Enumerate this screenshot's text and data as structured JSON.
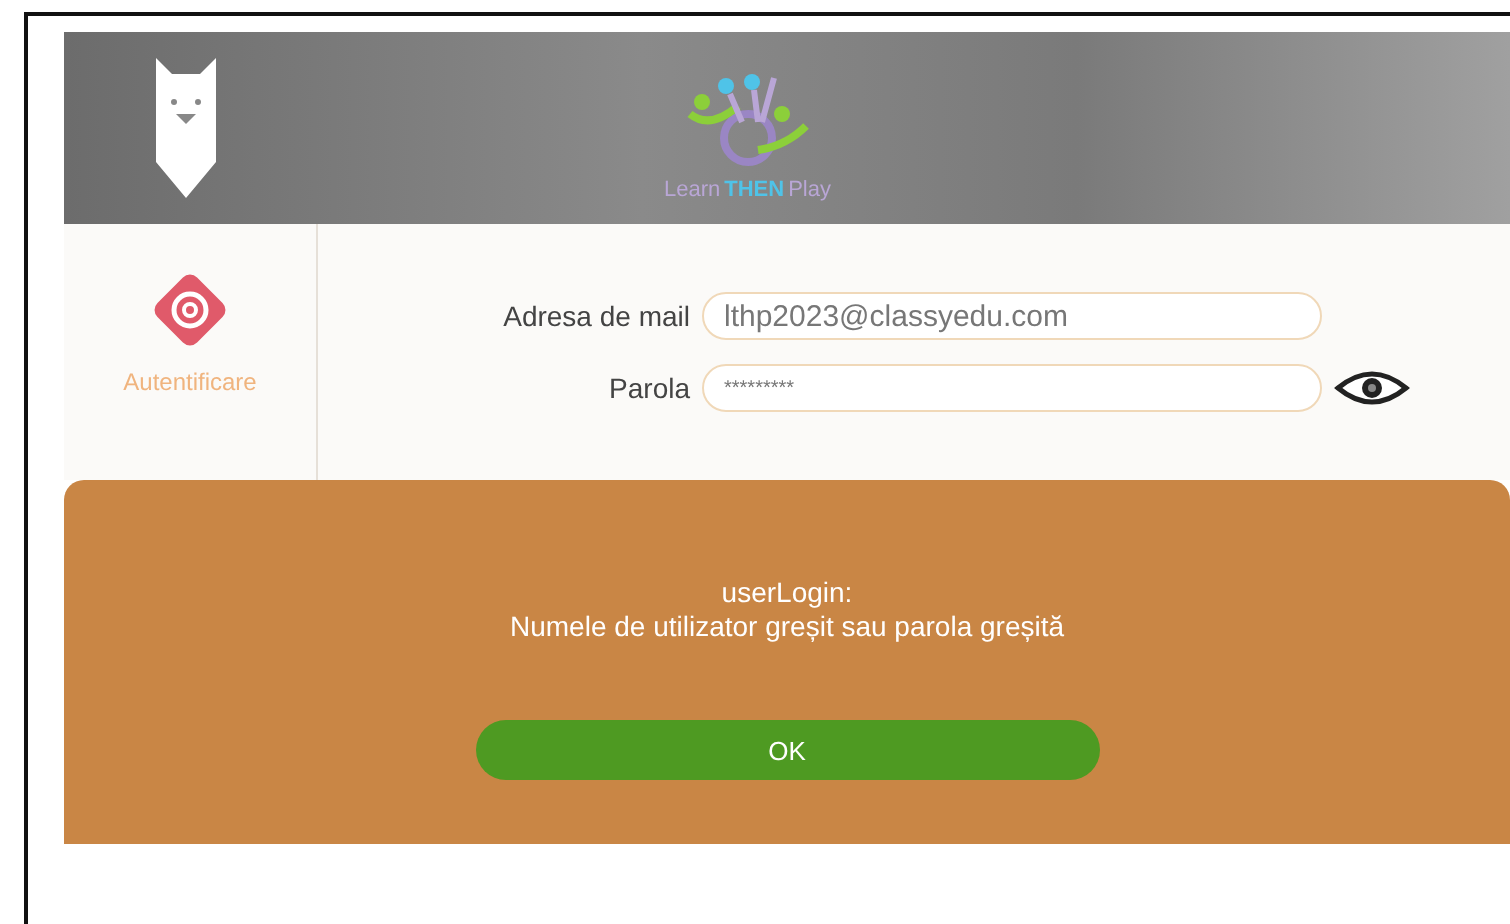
{
  "header": {
    "logo_words": [
      {
        "text": "Learn",
        "color": "#b9a6d6"
      },
      {
        "text": "THEN",
        "color": "#4fc3e8"
      },
      {
        "text": "Play",
        "color": "#b9a6d6"
      }
    ]
  },
  "sidebar": {
    "label": "Autentificare",
    "selected": true
  },
  "form": {
    "fields": [
      {
        "label": "Adresa de mail",
        "value": "lthp2023@classyedu.com",
        "kind": "email"
      },
      {
        "label": "Parola",
        "value": "*********",
        "kind": "password"
      }
    ]
  },
  "dialog": {
    "title": "userLogin:",
    "message": "Numele de utilizator greșit sau parola greșită",
    "button": "OK"
  }
}
